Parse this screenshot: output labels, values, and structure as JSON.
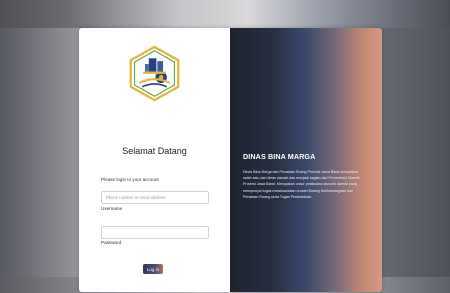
{
  "welcome": "Selamat Datang",
  "login_prompt": "Please login to your account",
  "username": {
    "placeholder": "Phone number or email address",
    "label": "Username"
  },
  "password": {
    "placeholder": "",
    "label": "Password"
  },
  "login_button": "Log in",
  "brand": {
    "title": "DINAS BINA MARGA",
    "description": "Dinas Bina Marga dan Penataan Ruang Provinsi Jawa Barat merupakan salah satu dari dinas daerah dan menjadi bagian dari Pemerintah Daerah Provinsi Jawa Barat. Merupakan unsur pelaksana otonomi daerah yang mempunyai tugas melaksanakan urusan Bidang Kebinamargaan dan Penataan Ruang serta Tugas Pembantuan."
  },
  "colors": {
    "accent_blue": "#2b3550",
    "accent_orange": "#b5705e",
    "logo_gold": "#e0b83c",
    "logo_blue": "#2a3f7a",
    "logo_green": "#6ea84a"
  },
  "icons": {
    "logo": "hexagon-emblem-icon"
  }
}
